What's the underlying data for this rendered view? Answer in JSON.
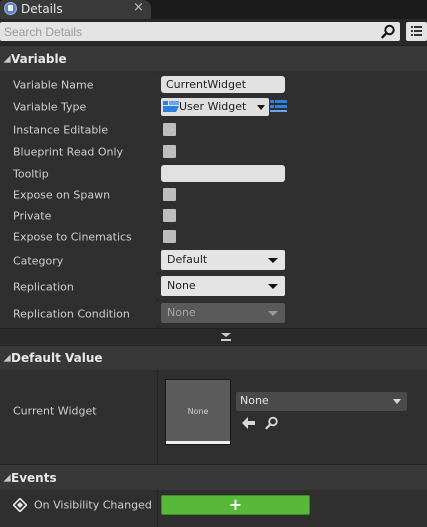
{
  "tab": {
    "title": "Details",
    "close": "×"
  },
  "search": {
    "placeholder": "Search Details",
    "value": ""
  },
  "sections": {
    "variable": "Variable",
    "default_value": "Default Value",
    "events": "Events"
  },
  "variable": {
    "name_label": "Variable Name",
    "name_value": "CurrentWidget",
    "type_label": "Variable Type",
    "type_value": "User Widget",
    "instance_editable_label": "Instance Editable",
    "instance_editable": false,
    "blueprint_read_only_label": "Blueprint Read Only",
    "blueprint_read_only": false,
    "tooltip_label": "Tooltip",
    "tooltip_value": "",
    "expose_on_spawn_label": "Expose on Spawn",
    "expose_on_spawn": false,
    "private_label": "Private",
    "private": false,
    "expose_to_cinematics_label": "Expose to Cinematics",
    "expose_to_cinematics": false,
    "category_label": "Category",
    "category_value": "Default",
    "replication_label": "Replication",
    "replication_value": "None",
    "replication_condition_label": "Replication Condition",
    "replication_condition_value": "None"
  },
  "default_value": {
    "current_widget_label": "Current Widget",
    "thumbnail_text": "None",
    "asset_value": "None"
  },
  "events": {
    "on_visibility_changed_label": "On Visibility Changed",
    "add_label": "+"
  },
  "colors": {
    "add_button": "#57b83a",
    "search_bg": "#e3e3e3",
    "panel_bg": "#2f2f2f"
  }
}
